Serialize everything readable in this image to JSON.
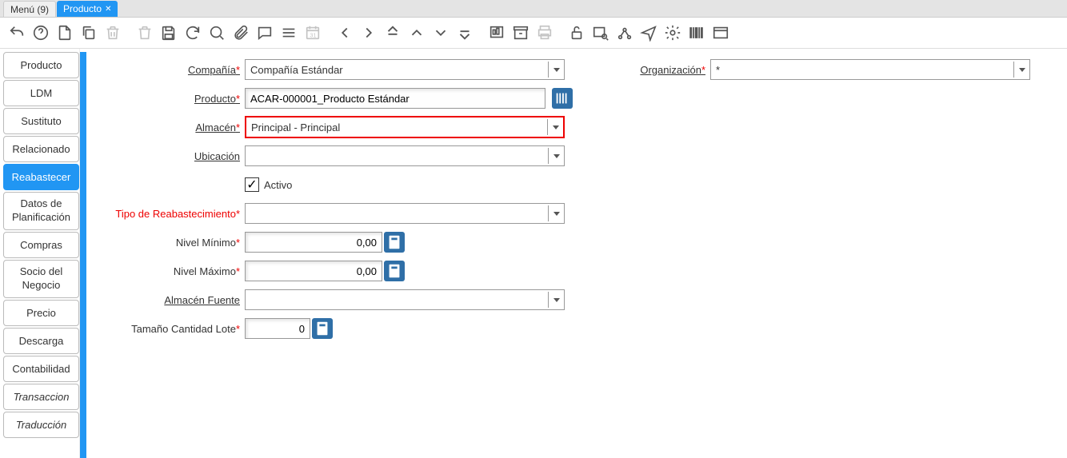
{
  "tabs": {
    "menu": "Menú (9)",
    "product": "Producto"
  },
  "sidebar": {
    "items": [
      {
        "label": "Producto"
      },
      {
        "label": "LDM"
      },
      {
        "label": "Sustituto"
      },
      {
        "label": "Relacionado"
      },
      {
        "label": "Reabastecer"
      },
      {
        "label": "Datos de\nPlanificación"
      },
      {
        "label": "Compras"
      },
      {
        "label": "Socio del\nNegocio"
      },
      {
        "label": "Precio"
      },
      {
        "label": "Descarga"
      },
      {
        "label": "Contabilidad"
      },
      {
        "label": "Transaccion"
      },
      {
        "label": "Traducción"
      }
    ]
  },
  "form": {
    "company": {
      "label": "Compañía",
      "value": "Compañía Estándar"
    },
    "organization": {
      "label": "Organización",
      "value": "*"
    },
    "product": {
      "label": "Producto",
      "value": "ACAR-000001_Producto Estándar"
    },
    "warehouse": {
      "label": "Almacén",
      "value": "Principal - Principal"
    },
    "location": {
      "label": "Ubicación",
      "value": ""
    },
    "active": {
      "label": "Activo",
      "checked": true
    },
    "replenish_type": {
      "label": "Tipo de Reabastecimiento",
      "value": ""
    },
    "min_level": {
      "label": "Nivel Mínimo",
      "value": "0,00"
    },
    "max_level": {
      "label": "Nivel Máximo",
      "value": "0,00"
    },
    "source_wh": {
      "label": "Almacén Fuente",
      "value": ""
    },
    "lot_qty": {
      "label": "Tamaño Cantidad Lote",
      "value": "0"
    }
  }
}
